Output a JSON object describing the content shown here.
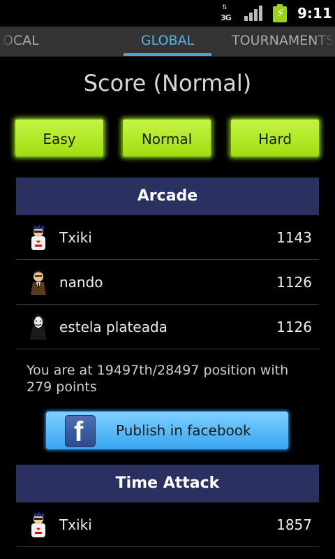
{
  "status_bar": {
    "network_type": "3G",
    "time": "9:11",
    "icons": [
      "data-activity-icon",
      "signal-icon",
      "battery-charging-icon"
    ]
  },
  "tabs": [
    {
      "label": "LOCAL",
      "selected": false
    },
    {
      "label": "GLOBAL",
      "selected": true
    },
    {
      "label": "TOURNAMENTS",
      "selected": false
    }
  ],
  "page_title": "Score (Normal)",
  "difficulty_buttons": [
    {
      "label": "Easy"
    },
    {
      "label": "Normal"
    },
    {
      "label": "Hard"
    }
  ],
  "arcade": {
    "title": "Arcade",
    "entries": [
      {
        "name": "Txiki",
        "score": "1143",
        "avatar": "avatar-i-love-icon"
      },
      {
        "name": "nando",
        "score": "1126",
        "avatar": "avatar-suit-icon"
      },
      {
        "name": "estela plateada",
        "score": "1126",
        "avatar": "avatar-mask-icon"
      }
    ],
    "position_text": "You are at 19497th/28497 position with 279 points",
    "facebook_button": "Publish in facebook"
  },
  "time_attack": {
    "title": "Time Attack",
    "entries": [
      {
        "name": "Txiki",
        "score": "1857",
        "avatar": "avatar-i-love-icon"
      }
    ]
  },
  "colors": {
    "accent_green": "#a6e31a",
    "section_header": "#2a3160",
    "tab_selected": "#4aa3df",
    "facebook_blue": "#39a5f0"
  }
}
